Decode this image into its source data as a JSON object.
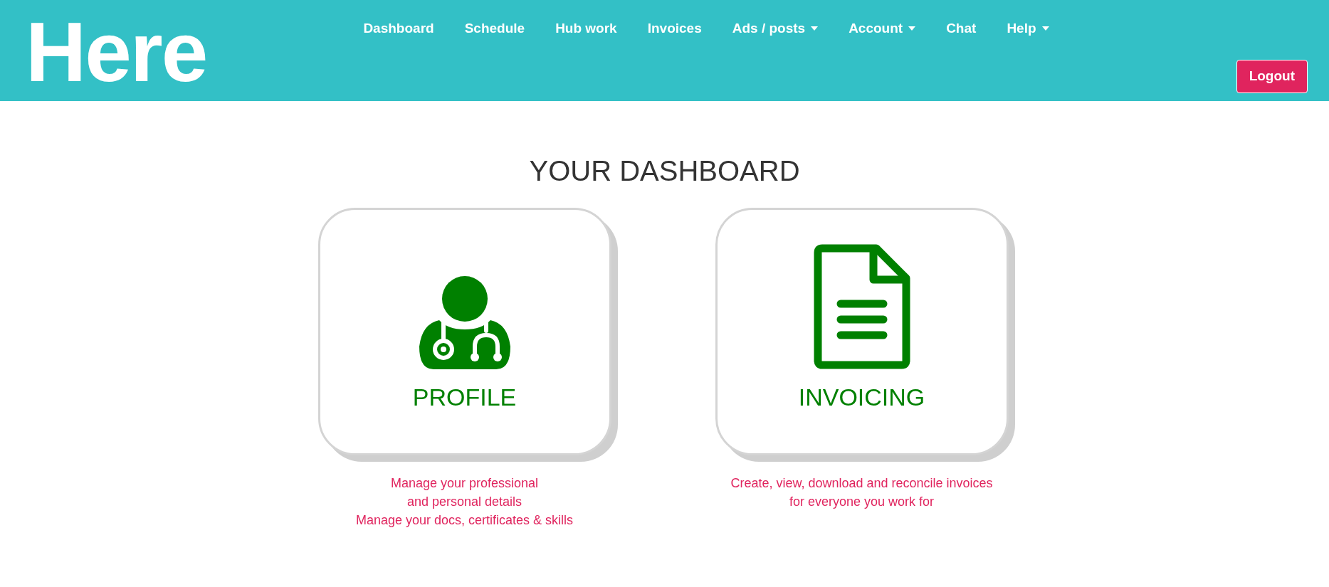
{
  "logo": "Here",
  "nav": [
    {
      "label": "Dashboard",
      "kind": "link"
    },
    {
      "label": "Schedule",
      "kind": "link"
    },
    {
      "label": "Hub work",
      "kind": "link"
    },
    {
      "label": "Invoices",
      "kind": "link"
    },
    {
      "label": "Ads / posts",
      "kind": "dropdown"
    },
    {
      "label": "Account",
      "kind": "dropdown"
    },
    {
      "label": "Chat",
      "kind": "link"
    },
    {
      "label": "Help",
      "kind": "dropdown"
    }
  ],
  "logout": "Logout",
  "title": "YOUR DASHBOARD",
  "cards": [
    {
      "kind": "profile",
      "label": "PROFILE",
      "description": [
        "Manage your professional",
        "and personal details",
        "Manage your docs, certificates & skills"
      ]
    },
    {
      "kind": "invoicing",
      "label": "INVOICING",
      "description": [
        "Create, view, download and reconcile invoices",
        "for everyone you work for"
      ]
    }
  ]
}
